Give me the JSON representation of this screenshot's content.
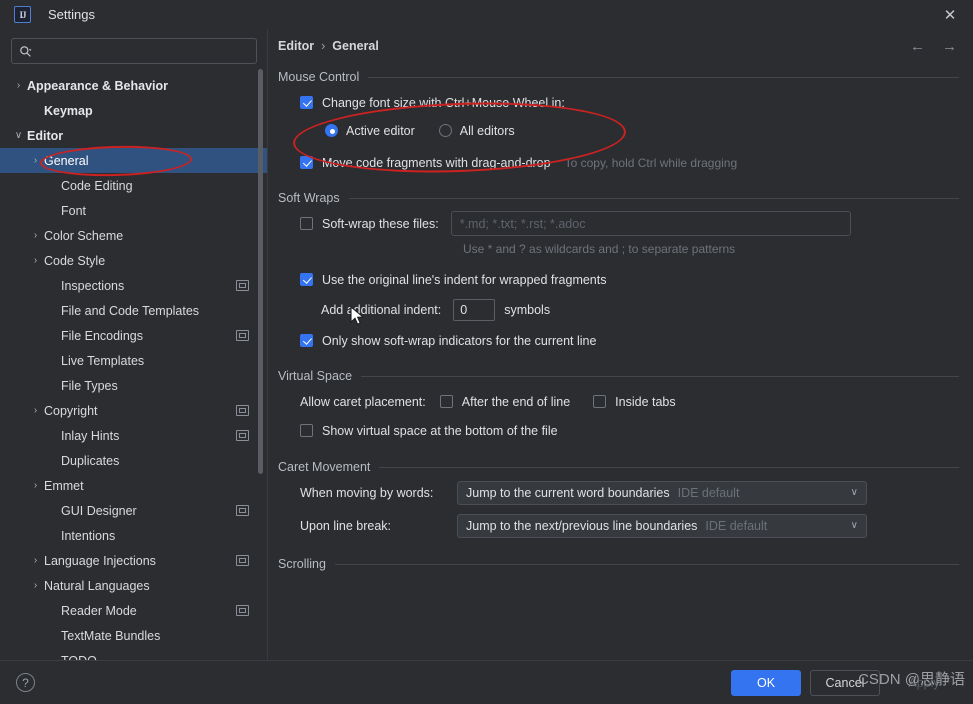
{
  "window": {
    "title": "Settings",
    "logo_text": "IJ",
    "close_label": "✕"
  },
  "search": {
    "value": "",
    "placeholder": ""
  },
  "sidebar": {
    "items": [
      {
        "label": "Appearance & Behavior",
        "level": 0,
        "arrow": "›",
        "bold": true,
        "badge": false,
        "selected": false
      },
      {
        "label": "Keymap",
        "level": 1,
        "arrow": "",
        "bold": true,
        "badge": false,
        "selected": false
      },
      {
        "label": "Editor",
        "level": 0,
        "arrow": "∨",
        "bold": true,
        "badge": false,
        "selected": false
      },
      {
        "label": "General",
        "level": 1,
        "arrow": "›",
        "bold": false,
        "badge": false,
        "selected": true
      },
      {
        "label": "Code Editing",
        "level": 2,
        "arrow": "",
        "bold": false,
        "badge": false,
        "selected": false
      },
      {
        "label": "Font",
        "level": 2,
        "arrow": "",
        "bold": false,
        "badge": false,
        "selected": false
      },
      {
        "label": "Color Scheme",
        "level": 1,
        "arrow": "›",
        "bold": false,
        "badge": false,
        "selected": false
      },
      {
        "label": "Code Style",
        "level": 1,
        "arrow": "›",
        "bold": false,
        "badge": false,
        "selected": false
      },
      {
        "label": "Inspections",
        "level": 2,
        "arrow": "",
        "bold": false,
        "badge": true,
        "selected": false
      },
      {
        "label": "File and Code Templates",
        "level": 2,
        "arrow": "",
        "bold": false,
        "badge": false,
        "selected": false
      },
      {
        "label": "File Encodings",
        "level": 2,
        "arrow": "",
        "bold": false,
        "badge": true,
        "selected": false
      },
      {
        "label": "Live Templates",
        "level": 2,
        "arrow": "",
        "bold": false,
        "badge": false,
        "selected": false
      },
      {
        "label": "File Types",
        "level": 2,
        "arrow": "",
        "bold": false,
        "badge": false,
        "selected": false
      },
      {
        "label": "Copyright",
        "level": 1,
        "arrow": "›",
        "bold": false,
        "badge": true,
        "selected": false
      },
      {
        "label": "Inlay Hints",
        "level": 2,
        "arrow": "",
        "bold": false,
        "badge": true,
        "selected": false
      },
      {
        "label": "Duplicates",
        "level": 2,
        "arrow": "",
        "bold": false,
        "badge": false,
        "selected": false
      },
      {
        "label": "Emmet",
        "level": 1,
        "arrow": "›",
        "bold": false,
        "badge": false,
        "selected": false
      },
      {
        "label": "GUI Designer",
        "level": 2,
        "arrow": "",
        "bold": false,
        "badge": true,
        "selected": false
      },
      {
        "label": "Intentions",
        "level": 2,
        "arrow": "",
        "bold": false,
        "badge": false,
        "selected": false
      },
      {
        "label": "Language Injections",
        "level": 1,
        "arrow": "›",
        "bold": false,
        "badge": true,
        "selected": false
      },
      {
        "label": "Natural Languages",
        "level": 1,
        "arrow": "›",
        "bold": false,
        "badge": false,
        "selected": false
      },
      {
        "label": "Reader Mode",
        "level": 2,
        "arrow": "",
        "bold": false,
        "badge": true,
        "selected": false
      },
      {
        "label": "TextMate Bundles",
        "level": 2,
        "arrow": "",
        "bold": false,
        "badge": false,
        "selected": false
      },
      {
        "label": "TODO",
        "level": 2,
        "arrow": "",
        "bold": false,
        "badge": false,
        "selected": false
      }
    ]
  },
  "breadcrumb": {
    "parent": "Editor",
    "separator": "›",
    "current": "General"
  },
  "nav": {
    "back": "←",
    "forward": "→"
  },
  "sections": {
    "mouse_control": {
      "title": "Mouse Control",
      "change_font_size_label": "Change font size with Ctrl+Mouse Wheel in:",
      "change_font_size_checked": true,
      "radio_active_editor": "Active editor",
      "radio_all_editors": "All editors",
      "radio_selected": "Active editor",
      "move_code_label": "Move code fragments with drag-and-drop",
      "move_code_checked": true,
      "move_code_hint": "To copy, hold Ctrl while dragging"
    },
    "soft_wraps": {
      "title": "Soft Wraps",
      "soft_wrap_files_label": "Soft-wrap these files:",
      "soft_wrap_files_checked": false,
      "soft_wrap_files_value": "",
      "soft_wrap_files_placeholder": "*.md; *.txt; *.rst; *.adoc",
      "wildcard_hint": "Use * and ? as wildcards and ; to separate patterns",
      "original_indent_label": "Use the original line's indent for wrapped fragments",
      "original_indent_checked": true,
      "additional_indent_label": "Add additional indent:",
      "additional_indent_value": "0",
      "additional_indent_suffix": "symbols",
      "only_show_indicators_label": "Only show soft-wrap indicators for the current line",
      "only_show_indicators_checked": true
    },
    "virtual_space": {
      "title": "Virtual Space",
      "allow_caret_label": "Allow caret placement:",
      "after_end_of_line_label": "After the end of line",
      "after_end_of_line_checked": false,
      "inside_tabs_label": "Inside tabs",
      "inside_tabs_checked": false,
      "show_virtual_space_label": "Show virtual space at the bottom of the file",
      "show_virtual_space_checked": false
    },
    "caret_movement": {
      "title": "Caret Movement",
      "when_moving_label": "When moving by words:",
      "when_moving_value": "Jump to the current word boundaries",
      "when_moving_default": "IDE default",
      "upon_line_break_label": "Upon line break:",
      "upon_line_break_value": "Jump to the next/previous line boundaries",
      "upon_line_break_default": "IDE default",
      "chevron": "∨"
    },
    "scrolling": {
      "title": "Scrolling"
    }
  },
  "footer": {
    "help_label": "?",
    "ok_label": "OK",
    "cancel_label": "Cancel",
    "apply_label": "Apply"
  },
  "watermark": {
    "text": "CSDN @思静语"
  },
  "colors": {
    "accent": "#3574f0",
    "selection": "#2f5280",
    "background": "#2b2d30",
    "annotation": "#cc2222"
  }
}
